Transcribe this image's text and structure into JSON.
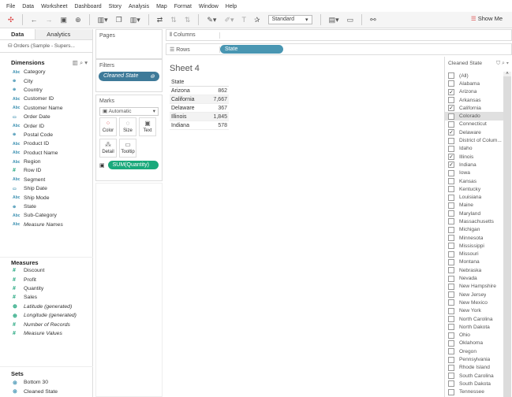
{
  "menu": [
    "File",
    "Data",
    "Worksheet",
    "Dashboard",
    "Story",
    "Analysis",
    "Map",
    "Format",
    "Window",
    "Help"
  ],
  "toolbar": {
    "mark_type_select": "Standard",
    "show_me": "Show Me"
  },
  "left": {
    "tabs": [
      "Data",
      "Analytics"
    ],
    "source": "Orders (Sample - Supers...",
    "dimensions_title": "Dimensions",
    "dimensions": [
      {
        "icon": "Abc",
        "label": "Category"
      },
      {
        "icon": "globe",
        "label": "City"
      },
      {
        "icon": "globe",
        "label": "Country"
      },
      {
        "icon": "Abc",
        "label": "Customer ID"
      },
      {
        "icon": "Abc",
        "label": "Customer Name"
      },
      {
        "icon": "calendar",
        "label": "Order Date"
      },
      {
        "icon": "Abc",
        "label": "Order ID"
      },
      {
        "icon": "globe",
        "label": "Postal Code"
      },
      {
        "icon": "Abc",
        "label": "Product ID"
      },
      {
        "icon": "Abc",
        "label": "Product Name"
      },
      {
        "icon": "Abc",
        "label": "Region"
      },
      {
        "icon": "#",
        "label": "Row ID"
      },
      {
        "icon": "Abc",
        "label": "Segment"
      },
      {
        "icon": "calendar",
        "label": "Ship Date"
      },
      {
        "icon": "Abc",
        "label": "Ship Mode"
      },
      {
        "icon": "globe",
        "label": "State"
      },
      {
        "icon": "Abc",
        "label": "Sub-Category"
      },
      {
        "icon": "Abc",
        "label": "Measure Names",
        "italic": true
      }
    ],
    "measures_title": "Measures",
    "measures": [
      {
        "icon": "#",
        "label": "Discount"
      },
      {
        "icon": "#",
        "label": "Profit"
      },
      {
        "icon": "#",
        "label": "Quantity"
      },
      {
        "icon": "#",
        "label": "Sales"
      },
      {
        "icon": "globe",
        "label": "Latitude (generated)",
        "italic": true
      },
      {
        "icon": "globe",
        "label": "Longitude (generated)",
        "italic": true
      },
      {
        "icon": "#",
        "label": "Number of Records",
        "italic": true
      },
      {
        "icon": "#",
        "label": "Measure Values",
        "italic": true
      }
    ],
    "sets_title": "Sets",
    "sets": [
      {
        "label": "Bottom 30"
      },
      {
        "label": "Cleaned State"
      }
    ]
  },
  "cards": {
    "pages": "Pages",
    "filters": "Filters",
    "filter_pill": "Cleaned State",
    "marks": "Marks",
    "marks_type": "Automatic",
    "buttons": [
      "Color",
      "Size",
      "Text",
      "Detail",
      "Tooltip"
    ],
    "measure_pill": "SUM(Quantity)"
  },
  "shelves": {
    "columns": "Columns",
    "rows": "Rows",
    "rows_pill": "State"
  },
  "sheet": {
    "title": "Sheet 4",
    "header": "State",
    "rows": [
      {
        "state": "Arizona",
        "value": "862"
      },
      {
        "state": "California",
        "value": "7,667"
      },
      {
        "state": "Delaware",
        "value": "367"
      },
      {
        "state": "Illinois",
        "value": "1,845"
      },
      {
        "state": "Indiana",
        "value": "578"
      }
    ]
  },
  "filter_card": {
    "title": "Cleaned State",
    "items": [
      {
        "label": "(All)",
        "checked": false
      },
      {
        "label": "Alabama",
        "checked": false
      },
      {
        "label": "Arizona",
        "checked": true
      },
      {
        "label": "Arkansas",
        "checked": false
      },
      {
        "label": "California",
        "checked": true
      },
      {
        "label": "Colorado",
        "checked": false,
        "hover": true
      },
      {
        "label": "Connecticut",
        "checked": false
      },
      {
        "label": "Delaware",
        "checked": true
      },
      {
        "label": "District of Colum...",
        "checked": false
      },
      {
        "label": "Idaho",
        "checked": false
      },
      {
        "label": "Illinois",
        "checked": true
      },
      {
        "label": "Indiana",
        "checked": true
      },
      {
        "label": "Iowa",
        "checked": false
      },
      {
        "label": "Kansas",
        "checked": false
      },
      {
        "label": "Kentucky",
        "checked": false
      },
      {
        "label": "Louisiana",
        "checked": false
      },
      {
        "label": "Maine",
        "checked": false
      },
      {
        "label": "Maryland",
        "checked": false
      },
      {
        "label": "Massachusetts",
        "checked": false
      },
      {
        "label": "Michigan",
        "checked": false
      },
      {
        "label": "Minnesota",
        "checked": false
      },
      {
        "label": "Mississippi",
        "checked": false
      },
      {
        "label": "Missouri",
        "checked": false
      },
      {
        "label": "Montana",
        "checked": false
      },
      {
        "label": "Nebraska",
        "checked": false
      },
      {
        "label": "Nevada",
        "checked": false
      },
      {
        "label": "New Hampshire",
        "checked": false
      },
      {
        "label": "New Jersey",
        "checked": false
      },
      {
        "label": "New Mexico",
        "checked": false
      },
      {
        "label": "New York",
        "checked": false
      },
      {
        "label": "North Carolina",
        "checked": false
      },
      {
        "label": "North Dakota",
        "checked": false
      },
      {
        "label": "Ohio",
        "checked": false
      },
      {
        "label": "Oklahoma",
        "checked": false
      },
      {
        "label": "Oregon",
        "checked": false
      },
      {
        "label": "Pennsylvania",
        "checked": false
      },
      {
        "label": "Rhode Island",
        "checked": false
      },
      {
        "label": "South Carolina",
        "checked": false
      },
      {
        "label": "South Dakota",
        "checked": false
      },
      {
        "label": "Tennessee",
        "checked": false
      }
    ]
  },
  "colors": {
    "filter_pill": "#3e7a99",
    "dim_pill": "#4996b2",
    "measure_pill": "#1aa97b"
  }
}
